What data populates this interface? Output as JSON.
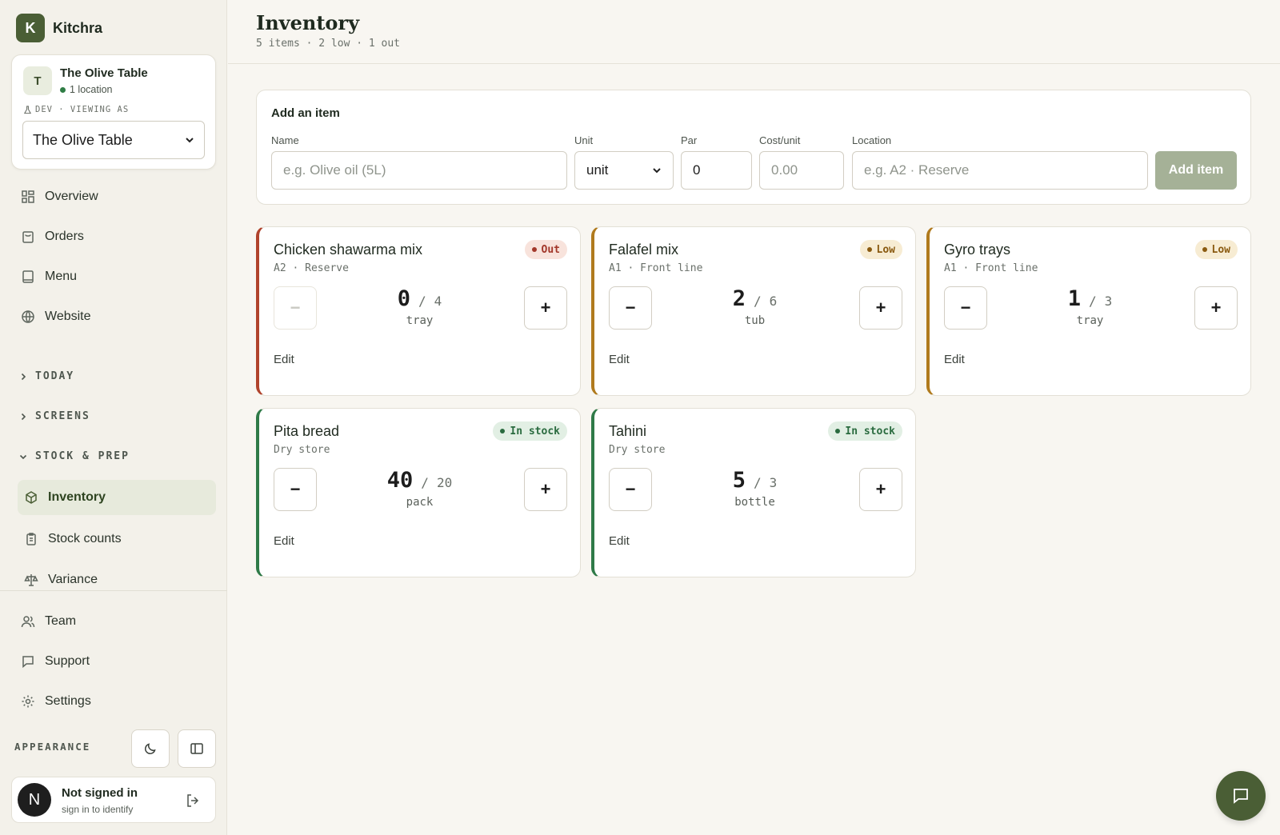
{
  "brand": {
    "logo_letter": "K",
    "name": "Kitchra"
  },
  "org": {
    "avatar_letter": "T",
    "name": "The Olive Table",
    "locations": "1 location",
    "viewing_label": "DEV · VIEWING AS",
    "selected": "The Olive Table"
  },
  "nav": {
    "overview": "Overview",
    "orders": "Orders",
    "menu": "Menu",
    "website": "Website",
    "today": "TODAY",
    "screens": "SCREENS",
    "stock_prep": "STOCK & PREP",
    "inventory": "Inventory",
    "stock_counts": "Stock counts",
    "variance": "Variance",
    "team": "Team",
    "support": "Support",
    "settings": "Settings",
    "appearance": "APPEARANCE"
  },
  "user": {
    "avatar_letter": "N",
    "name": "Not signed in",
    "sub": "sign in to identify"
  },
  "header": {
    "title": "Inventory",
    "subtitle": "5 items · 2 low · 1 out"
  },
  "add_form": {
    "title": "Add an item",
    "name_label": "Name",
    "name_placeholder": "e.g. Olive oil (5L)",
    "unit_label": "Unit",
    "unit_value": "unit",
    "par_label": "Par",
    "par_value": "0",
    "cost_label": "Cost/unit",
    "cost_placeholder": "0.00",
    "location_label": "Location",
    "location_placeholder": "e.g. A2 · Reserve",
    "submit": "Add item"
  },
  "edit_label": "Edit",
  "items": [
    {
      "name": "Chicken shawarma mix",
      "location": "A2 · Reserve",
      "status": "Out",
      "qty": "0",
      "par": "4",
      "unit": "tray"
    },
    {
      "name": "Falafel mix",
      "location": "A1 · Front line",
      "status": "Low",
      "qty": "2",
      "par": "6",
      "unit": "tub"
    },
    {
      "name": "Gyro trays",
      "location": "A1 · Front line",
      "status": "Low",
      "qty": "1",
      "par": "3",
      "unit": "tray"
    },
    {
      "name": "Pita bread",
      "location": "Dry store",
      "status": "In stock",
      "qty": "40",
      "par": "20",
      "unit": "pack"
    },
    {
      "name": "Tahini",
      "location": "Dry store",
      "status": "In stock",
      "qty": "5",
      "par": "3",
      "unit": "bottle"
    }
  ],
  "colors": {
    "brand": "#4a5e35",
    "out": "#b0432c",
    "low": "#b07a1d",
    "in_stock": "#2f7a48"
  }
}
